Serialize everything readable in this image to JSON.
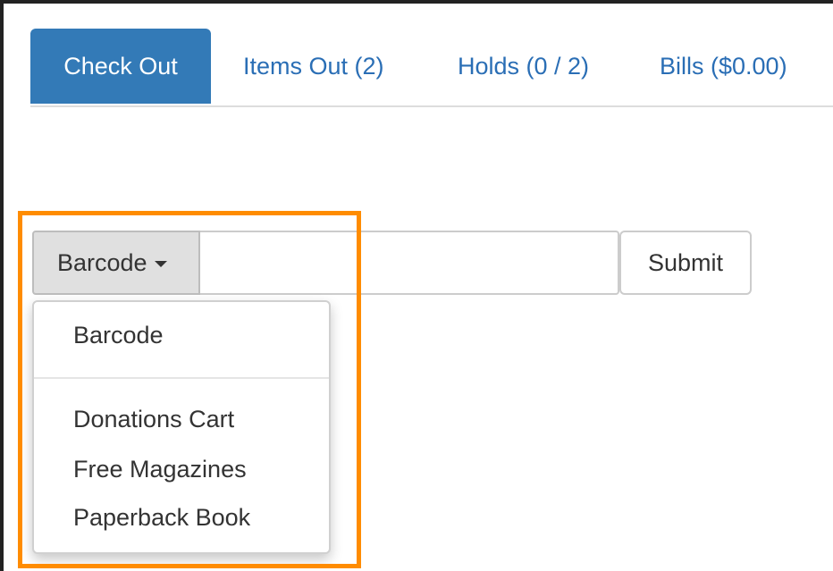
{
  "tabs": [
    {
      "label": "Check Out",
      "active": true
    },
    {
      "label": "Items Out (2)",
      "active": false
    },
    {
      "label": "Holds (0 / 2)",
      "active": false
    },
    {
      "label": "Bills ($0.00)",
      "active": false
    }
  ],
  "checkout_form": {
    "dropdown_label": "Barcode",
    "input_value": "",
    "submit_label": "Submit"
  },
  "dropdown_menu": {
    "items": [
      "Barcode",
      "Donations Cart",
      "Free Magazines",
      "Paperback Book"
    ]
  },
  "colors": {
    "active_tab": "#337ab7",
    "link": "#2a6eb5",
    "highlight_box": "#ff8c00"
  }
}
